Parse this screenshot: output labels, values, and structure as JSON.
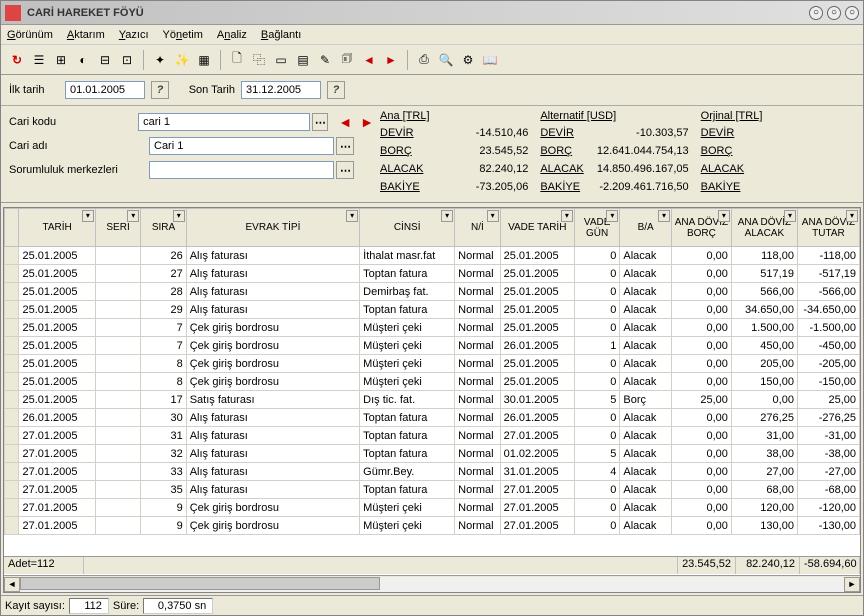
{
  "title": "CARİ HAREKET FÖYÜ",
  "menu": [
    "Görünüm",
    "Aktarım",
    "Yazıcı",
    "Yönetim",
    "Analiz",
    "Bağlantı"
  ],
  "filters": {
    "first_date_label": "İlk tarih",
    "first_date": "01.01.2005",
    "last_date_label": "Son Tarih",
    "last_date": "31.12.2005"
  },
  "form": {
    "cari_kodu_label": "Cari kodu",
    "cari_kodu": "cari 1",
    "cari_adi_label": "Cari adı",
    "cari_adi": "Cari 1",
    "sorumluluk_label": "Sorumluluk merkezleri",
    "sorumluluk": ""
  },
  "summary": {
    "cols": [
      {
        "header": "Ana [TRL]",
        "devir": "-14.510,46",
        "borc": "23.545,52",
        "alacak": "82.240,12",
        "bakiye": "-73.205,06"
      },
      {
        "header": "Alternatif [USD]",
        "devir": "-10.303,57",
        "borc": "12.641.044.754,13",
        "alacak": "14.850.496.167,05",
        "bakiye": "-2.209.461.716,50"
      },
      {
        "header": "Orjinal [TRL]",
        "devir": "",
        "borc": "",
        "alacak": "",
        "bakiye": ""
      }
    ],
    "labels": {
      "devir": "DEVİR",
      "borc": "BORÇ",
      "alacak": "ALACAK",
      "bakiye": "BAKİYE"
    }
  },
  "columns": [
    "TARİH",
    "SERİ",
    "SIRA",
    "EVRAK TİPİ",
    "CİNSİ",
    "N/İ",
    "VADE TARİH",
    "VADE GÜN",
    "B/A",
    "ANA DÖVİZ BORÇ",
    "ANA DÖVİZ ALACAK",
    "ANA DÖVİZ TUTAR"
  ],
  "rows": [
    {
      "tarih": "25.01.2005",
      "seri": "",
      "sira": "26",
      "tip": "Alış faturası",
      "cinsi": "İthalat masr.fat",
      "ni": "Normal",
      "vade": "25.01.2005",
      "gun": "0",
      "ba": "Alacak",
      "borc": "0,00",
      "alacak": "118,00",
      "tutar": "-118,00"
    },
    {
      "tarih": "25.01.2005",
      "seri": "",
      "sira": "27",
      "tip": "Alış faturası",
      "cinsi": "Toptan fatura",
      "ni": "Normal",
      "vade": "25.01.2005",
      "gun": "0",
      "ba": "Alacak",
      "borc": "0,00",
      "alacak": "517,19",
      "tutar": "-517,19"
    },
    {
      "tarih": "25.01.2005",
      "seri": "",
      "sira": "28",
      "tip": "Alış faturası",
      "cinsi": "Demirbaş fat.",
      "ni": "Normal",
      "vade": "25.01.2005",
      "gun": "0",
      "ba": "Alacak",
      "borc": "0,00",
      "alacak": "566,00",
      "tutar": "-566,00"
    },
    {
      "tarih": "25.01.2005",
      "seri": "",
      "sira": "29",
      "tip": "Alış faturası",
      "cinsi": "Toptan fatura",
      "ni": "Normal",
      "vade": "25.01.2005",
      "gun": "0",
      "ba": "Alacak",
      "borc": "0,00",
      "alacak": "34.650,00",
      "tutar": "-34.650,00"
    },
    {
      "tarih": "25.01.2005",
      "seri": "",
      "sira": "7",
      "tip": "Çek giriş bordrosu",
      "cinsi": "Müşteri çeki",
      "ni": "Normal",
      "vade": "25.01.2005",
      "gun": "0",
      "ba": "Alacak",
      "borc": "0,00",
      "alacak": "1.500,00",
      "tutar": "-1.500,00"
    },
    {
      "tarih": "25.01.2005",
      "seri": "",
      "sira": "7",
      "tip": "Çek giriş bordrosu",
      "cinsi": "Müşteri çeki",
      "ni": "Normal",
      "vade": "26.01.2005",
      "gun": "1",
      "ba": "Alacak",
      "borc": "0,00",
      "alacak": "450,00",
      "tutar": "-450,00"
    },
    {
      "tarih": "25.01.2005",
      "seri": "",
      "sira": "8",
      "tip": "Çek giriş bordrosu",
      "cinsi": "Müşteri çeki",
      "ni": "Normal",
      "vade": "25.01.2005",
      "gun": "0",
      "ba": "Alacak",
      "borc": "0,00",
      "alacak": "205,00",
      "tutar": "-205,00"
    },
    {
      "tarih": "25.01.2005",
      "seri": "",
      "sira": "8",
      "tip": "Çek giriş bordrosu",
      "cinsi": "Müşteri çeki",
      "ni": "Normal",
      "vade": "25.01.2005",
      "gun": "0",
      "ba": "Alacak",
      "borc": "0,00",
      "alacak": "150,00",
      "tutar": "-150,00"
    },
    {
      "tarih": "25.01.2005",
      "seri": "",
      "sira": "17",
      "tip": "Satış faturası",
      "cinsi": "Dış tic. fat.",
      "ni": "Normal",
      "vade": "30.01.2005",
      "gun": "5",
      "ba": "Borç",
      "borc": "25,00",
      "alacak": "0,00",
      "tutar": "25,00"
    },
    {
      "tarih": "26.01.2005",
      "seri": "",
      "sira": "30",
      "tip": "Alış faturası",
      "cinsi": "Toptan fatura",
      "ni": "Normal",
      "vade": "26.01.2005",
      "gun": "0",
      "ba": "Alacak",
      "borc": "0,00",
      "alacak": "276,25",
      "tutar": "-276,25"
    },
    {
      "tarih": "27.01.2005",
      "seri": "",
      "sira": "31",
      "tip": "Alış faturası",
      "cinsi": "Toptan fatura",
      "ni": "Normal",
      "vade": "27.01.2005",
      "gun": "0",
      "ba": "Alacak",
      "borc": "0,00",
      "alacak": "31,00",
      "tutar": "-31,00"
    },
    {
      "tarih": "27.01.2005",
      "seri": "",
      "sira": "32",
      "tip": "Alış faturası",
      "cinsi": "Toptan fatura",
      "ni": "Normal",
      "vade": "01.02.2005",
      "gun": "5",
      "ba": "Alacak",
      "borc": "0,00",
      "alacak": "38,00",
      "tutar": "-38,00"
    },
    {
      "tarih": "27.01.2005",
      "seri": "",
      "sira": "33",
      "tip": "Alış faturası",
      "cinsi": "Gümr.Bey.",
      "ni": "Normal",
      "vade": "31.01.2005",
      "gun": "4",
      "ba": "Alacak",
      "borc": "0,00",
      "alacak": "27,00",
      "tutar": "-27,00"
    },
    {
      "tarih": "27.01.2005",
      "seri": "",
      "sira": "35",
      "tip": "Alış faturası",
      "cinsi": "Toptan fatura",
      "ni": "Normal",
      "vade": "27.01.2005",
      "gun": "0",
      "ba": "Alacak",
      "borc": "0,00",
      "alacak": "68,00",
      "tutar": "-68,00"
    },
    {
      "tarih": "27.01.2005",
      "seri": "",
      "sira": "9",
      "tip": "Çek giriş bordrosu",
      "cinsi": "Müşteri çeki",
      "ni": "Normal",
      "vade": "27.01.2005",
      "gun": "0",
      "ba": "Alacak",
      "borc": "0,00",
      "alacak": "120,00",
      "tutar": "-120,00"
    },
    {
      "tarih": "27.01.2005",
      "seri": "",
      "sira": "9",
      "tip": "Çek giriş bordrosu",
      "cinsi": "Müşteri çeki",
      "ni": "Normal",
      "vade": "27.01.2005",
      "gun": "0",
      "ba": "Alacak",
      "borc": "0,00",
      "alacak": "130,00",
      "tutar": "-130,00"
    }
  ],
  "footer": {
    "count_label": "Adet=112",
    "borc_total": "23.545,52",
    "alacak_total": "82.240,12",
    "tutar_total": "-58.694,60"
  },
  "status": {
    "kayit_label": "Kayıt sayısı:",
    "kayit": "112",
    "sure_label": "Süre:",
    "sure": "0,3750 sn"
  }
}
